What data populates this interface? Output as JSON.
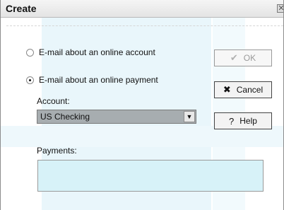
{
  "dialog": {
    "title": "Create",
    "close_glyph": "✕"
  },
  "options": {
    "account_label": "E-mail about an online account",
    "account_checked": false,
    "payment_label": "E-mail about an online payment",
    "payment_checked": true
  },
  "account": {
    "label": "Account:",
    "selected": "US Checking"
  },
  "payments": {
    "label": "Payments:",
    "value": ""
  },
  "buttons": {
    "ok": {
      "label": "OK",
      "icon": "check-icon",
      "glyph": "✔",
      "enabled": false
    },
    "cancel": {
      "label": "Cancel",
      "icon": "x-icon",
      "glyph": "✖"
    },
    "help": {
      "label": "Help",
      "icon": "help-icon",
      "glyph": "?"
    }
  },
  "colors": {
    "select_bg": "#a7adb0",
    "payments_bg": "#d7f2f8",
    "watermark": "#e9f6fb"
  }
}
